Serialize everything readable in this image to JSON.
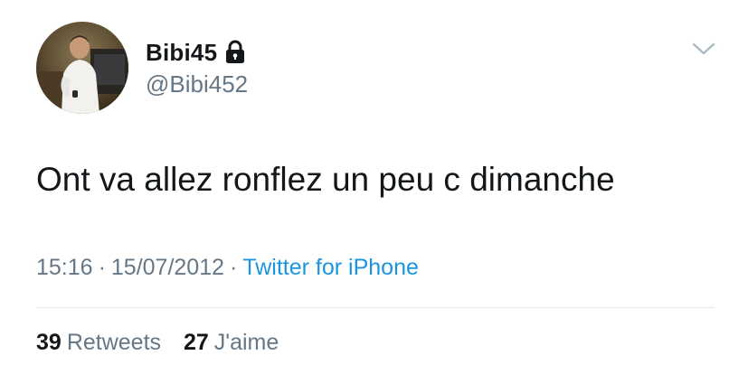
{
  "user": {
    "display_name": "Bibi45",
    "handle": "@Bibi452",
    "avatar_icon": "profile-photo",
    "lock_icon": "lock-icon"
  },
  "tweet": {
    "text": "Ont va allez ronflez un peu c dimanche",
    "time": "15:16",
    "separator": "·",
    "date": "15/07/2012",
    "source": "Twitter for iPhone"
  },
  "stats": {
    "retweets_count": "39",
    "retweets_label": "Retweets",
    "likes_count": "27",
    "likes_label": "J'aime"
  },
  "colors": {
    "text": "#14171a",
    "secondary": "#657786",
    "link": "#1b95e0",
    "divider": "#e1e8ed"
  }
}
